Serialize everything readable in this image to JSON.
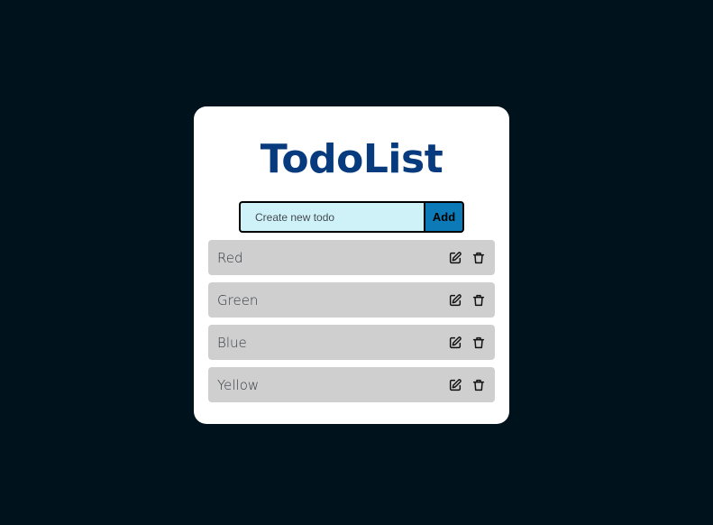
{
  "app": {
    "title": "TodoList"
  },
  "form": {
    "placeholder": "Create new todo",
    "value": "",
    "add_label": "Add"
  },
  "todos": [
    {
      "text": "Red"
    },
    {
      "text": "Green"
    },
    {
      "text": "Blue"
    },
    {
      "text": "Yellow"
    }
  ],
  "icons": {
    "edit": "edit-icon",
    "delete": "trash-icon"
  },
  "colors": {
    "background": "#00131d",
    "card": "#ffffff",
    "title": "#073b7e",
    "input_bg": "#cff1f8",
    "button_bg": "#0b7ab7",
    "item_bg": "#cfcfcf"
  }
}
